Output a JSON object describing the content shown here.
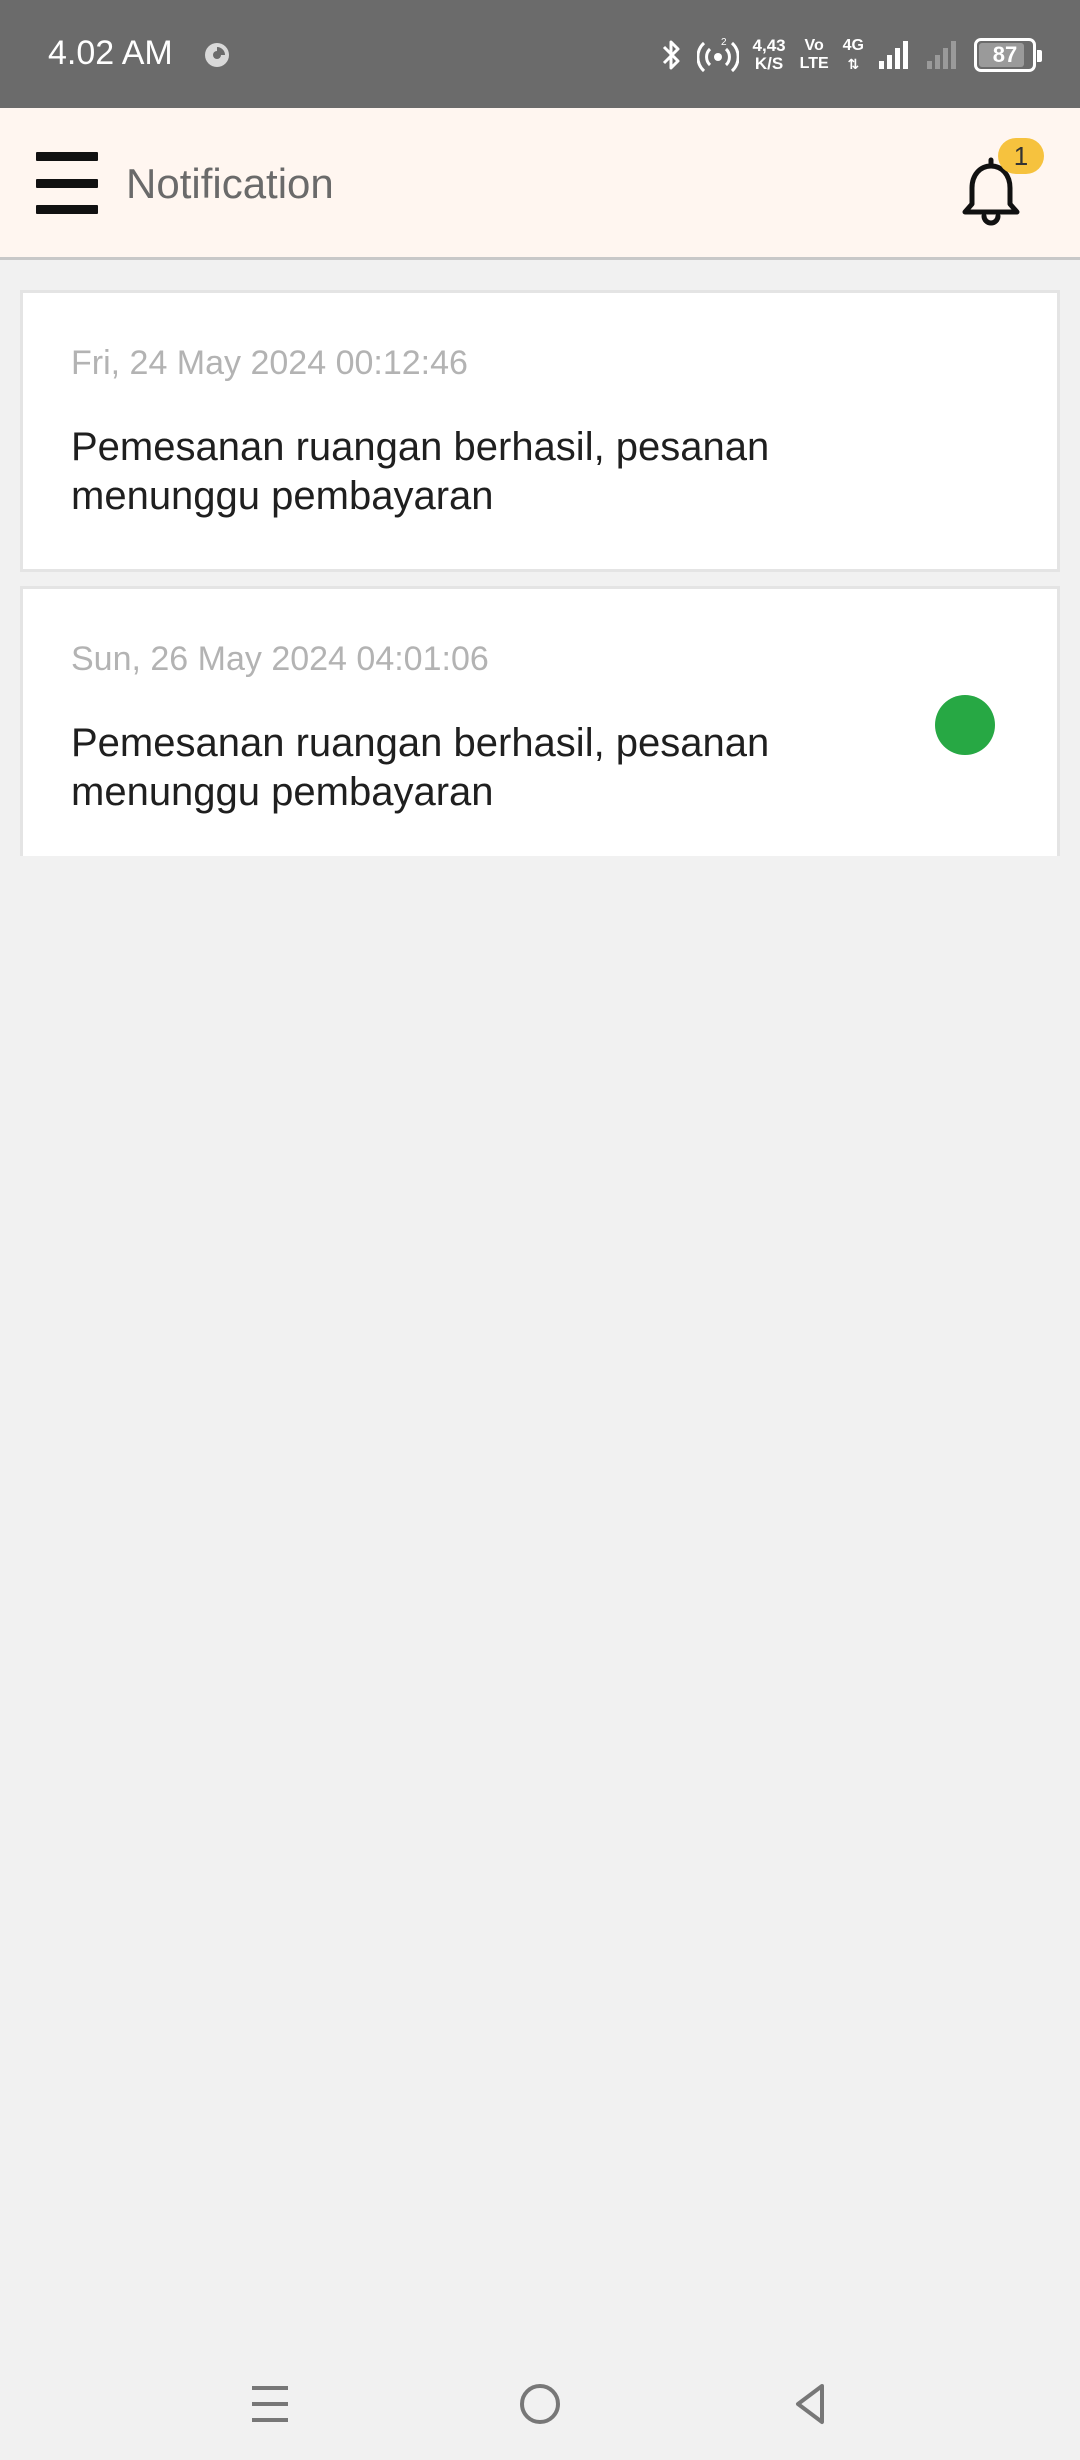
{
  "status_bar": {
    "time": "4.02 AM",
    "net_speed_value": "4,43",
    "net_speed_unit": "K/S",
    "volte_top": "Vo",
    "volte_bottom": "LTE",
    "network_type": "4G",
    "battery_level": "87",
    "battery_percent": 87,
    "icons": [
      "sync-icon",
      "bluetooth-icon",
      "hotspot-icon",
      "signal-icon",
      "battery-icon"
    ]
  },
  "app_bar": {
    "title": "Notification",
    "badge_count": "1",
    "icons": [
      "hamburger-menu-icon",
      "bell-icon"
    ]
  },
  "notifications": [
    {
      "date": "Fri, 24 May 2024 00:12:46",
      "message": "Pemesanan ruangan berhasil, pesanan menunggu pembayaran",
      "unread": false
    },
    {
      "date": "Sun, 26 May 2024 04:01:06",
      "message": "Pemesanan ruangan berhasil, pesanan menunggu pembayaran",
      "unread": true
    }
  ],
  "colors": {
    "status_bar": "#6b6b6b",
    "app_bar": "#fff6f0",
    "badge": "#f6c23e",
    "unread_dot": "#27a844",
    "background": "#f1f1f1"
  },
  "nav_bar": {
    "icons": [
      "recents-icon",
      "home-icon",
      "back-icon"
    ]
  }
}
